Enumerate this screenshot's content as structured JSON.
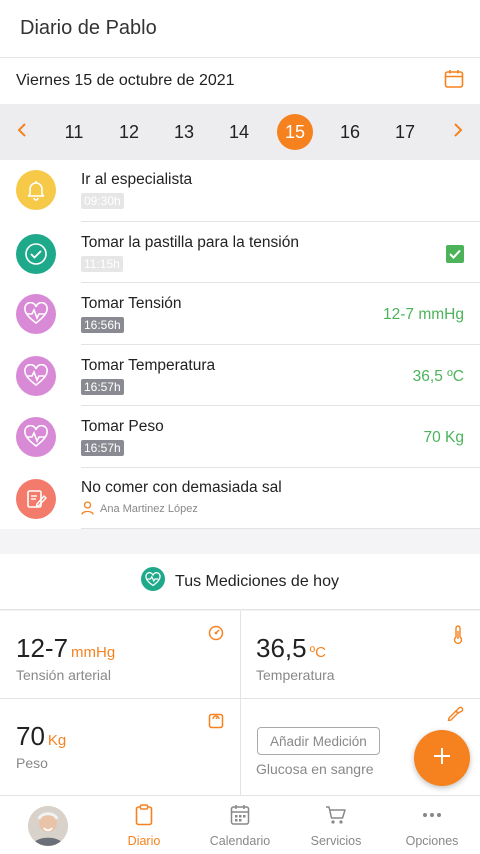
{
  "header": {
    "title": "Diario de Pablo"
  },
  "date": {
    "label": "Viernes 15 de octubre de 2021",
    "icon": "calendar-icon"
  },
  "week": {
    "days": [
      "11",
      "12",
      "13",
      "14",
      "15",
      "16",
      "17"
    ],
    "selected": "15",
    "prev_icon": "chevron-left-icon",
    "next_icon": "chevron-right-icon"
  },
  "items": [
    {
      "title": "Ir al especialista",
      "time": "09:30h",
      "icon": "bell-icon",
      "color": "#f7c948"
    },
    {
      "title": "Tomar la pastilla para la tensión",
      "time": "11:15h",
      "icon": "check-circle-icon",
      "color": "#1fa98b",
      "checked": true
    },
    {
      "title": "Tomar Tensión",
      "time": "16:56h",
      "value": "12-7 mmHg",
      "icon": "heart-pulse-icon",
      "color": "#d98ad6"
    },
    {
      "title": "Tomar Temperatura",
      "time": "16:57h",
      "value": "36,5 ºC",
      "icon": "heart-pulse-icon",
      "color": "#d98ad6"
    },
    {
      "title": "Tomar Peso",
      "time": "16:57h",
      "value": "70 Kg",
      "icon": "heart-pulse-icon",
      "color": "#d98ad6"
    },
    {
      "title": "No comer con demasiada sal",
      "author": "Ana Martinez López",
      "icon": "edit-icon",
      "color": "#f27b6b"
    }
  ],
  "measurements": {
    "title": "Tus Mediciones de hoy",
    "cards": [
      {
        "value": "12-7",
        "unit": "mmHg",
        "label": "Tensión arterial",
        "icon": "gauge-icon"
      },
      {
        "value": "36,5",
        "unit": "ºC",
        "label": "Temperatura",
        "icon": "thermometer-icon"
      },
      {
        "value": "70",
        "unit": "Kg",
        "label": "Peso",
        "icon": "scale-icon"
      },
      {
        "button": "Añadir Medición",
        "label": "Glucosa en sangre",
        "icon": "pipette-icon"
      }
    ]
  },
  "fab": {
    "icon": "plus-icon"
  },
  "tabbar": {
    "tabs": [
      {
        "label": "Diario",
        "icon": "clipboard-icon",
        "active": true
      },
      {
        "label": "Calendario",
        "icon": "calendar-icon"
      },
      {
        "label": "Servicios",
        "icon": "cart-icon"
      },
      {
        "label": "Opciones",
        "icon": "more-icon"
      }
    ]
  },
  "colors": {
    "accent": "#f5821f",
    "value_green": "#4cb35a",
    "teal": "#1fa98b"
  }
}
